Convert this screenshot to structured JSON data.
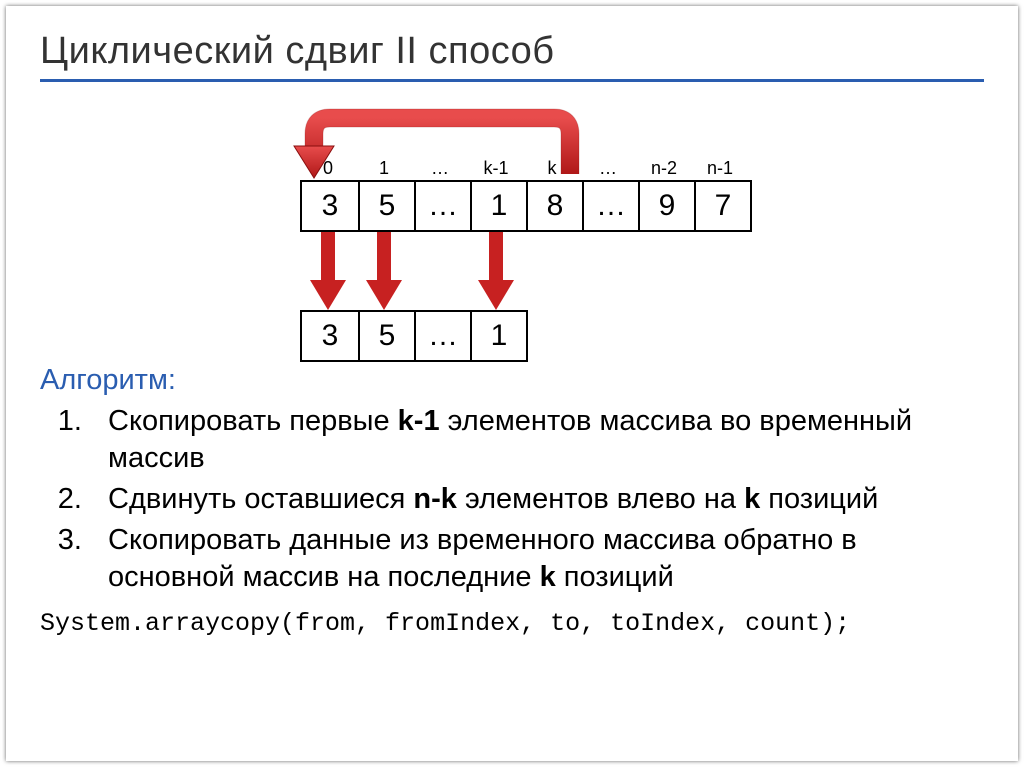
{
  "title": "Циклический сдвиг II способ",
  "indices": [
    "0",
    "1",
    "…",
    "k-1",
    "k",
    "…",
    "n-2",
    "n-1"
  ],
  "array_top": [
    "3",
    "5",
    "…",
    "1",
    "8",
    "…",
    "9",
    "7"
  ],
  "array_bottom": [
    "3",
    "5",
    "…",
    "1"
  ],
  "algo_label": "Алгоритм:",
  "steps": {
    "s1a": "Скопировать первые ",
    "s1b": "k-1",
    "s1c": " элементов массива во временный массив",
    "s2a": "Сдвинуть оставшиеся ",
    "s2b": "n-k",
    "s2c": " элементов влево на ",
    "s2d": "k",
    "s2e": " позиций",
    "s3a": "Скопировать данные из временного массива обратно в основной массив на последние ",
    "s3b": "k",
    "s3c": " позиций"
  },
  "code": "System.arraycopy(from, fromIndex, to, toIndex, count);"
}
